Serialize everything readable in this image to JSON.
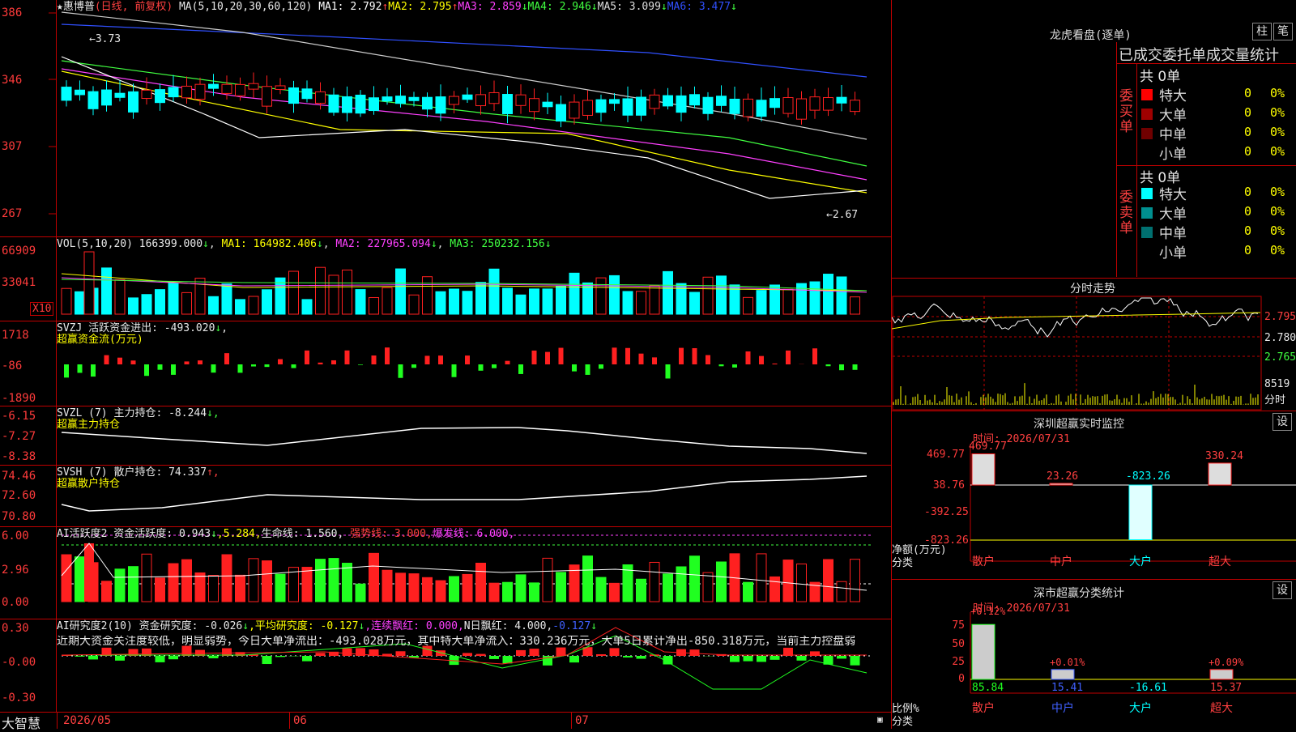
{
  "colors": {
    "up": "#ff2020",
    "down": "#00ffff",
    "grid": "#c00000",
    "axis": "#ff3b3b"
  },
  "main": {
    "star": "★",
    "name": "惠博普",
    "period": "(日线, 前复权)",
    "ma_params": "MA(5,10,20,30,60,120)",
    "ma": [
      {
        "label": "MA1: 2.792",
        "arrow": "↑",
        "color": "#ffffff"
      },
      {
        "label": "MA2: 2.795",
        "arrow": "↑",
        "color": "#ffff00"
      },
      {
        "label": "MA3: 2.859",
        "arrow": "↓",
        "color": "#ff40ff"
      },
      {
        "label": "MA4: 2.946",
        "arrow": "↓",
        "color": "#40ff40"
      },
      {
        "label": "MA5: 3.099",
        "arrow": "↓",
        "color": "#dddddd"
      },
      {
        "label": "MA6: 3.477",
        "arrow": "↓",
        "color": "#3050ff"
      }
    ],
    "yticks": [
      "386",
      "346",
      "307",
      "267"
    ],
    "hi_note": "3.73",
    "lo_note": "←2.67"
  },
  "vol": {
    "title": "VOL(5,10,20)",
    "value": "166399.000",
    "arrow": "↓",
    "ma1": "MA1: 164982.406",
    "ma1_arrow": "↓",
    "ma2": "MA2: 227965.094",
    "ma2_arrow": "↓",
    "ma3": "MA3: 250232.156",
    "ma3_arrow": "↓",
    "yticks": [
      "66909",
      "33041"
    ],
    "unit": "X10"
  },
  "svzj": {
    "title": "SVZJ  活跃资金进出: -493.020",
    "arrow": "↓",
    "sub": "超赢资金流(万元)",
    "yticks": [
      "1718",
      "-86",
      "-1890"
    ]
  },
  "svzl": {
    "title": "SVZL (7) 主力持仓: -8.244",
    "arrow": "↓,",
    "sub": "超赢主力持仓",
    "yticks": [
      "-6.15",
      "-7.27",
      "-8.38"
    ]
  },
  "svsh": {
    "title": "SVSH (7) 散户持仓: 74.337",
    "arrow": "↑,",
    "sub": "超赢散户持仓",
    "yticks": [
      "74.46",
      "72.60",
      "70.80"
    ]
  },
  "ai1": {
    "title": "AI活跃度2 资金活跃度: 0.943",
    "arrow": "↓",
    "v2": ",5.284,",
    "life": "生命线: 1.560,",
    "strong": "强势线: 3.000,",
    "burst": "爆发线: 6.000,",
    "yticks": [
      "6.00",
      "2.96",
      "0.00"
    ]
  },
  "ai2": {
    "title": "AI研究度2(10) 资金研究度: -0.026",
    "arrow": "↓",
    "avg": ",平均研究度: -0.127",
    "avg_arrow": "↓",
    "red": ",连续飘红: 0.000,",
    "nred": "N日飘红: 4.000,",
    "tail": "-0.127",
    "tail_arrow": "↓",
    "note": "近期大资金关注度较低，明显弱势，今日大单净流出：-493.028万元，其中特大单净流入：330.236万元，大单5日累计净出-850.318万元，当前主力控盘弱",
    "yticks": [
      "0.30",
      "-0.00",
      "-0.30"
    ]
  },
  "xaxis": {
    "brand": "大智慧",
    "labels": [
      "2026/05",
      "06",
      "07"
    ]
  },
  "lhb": {
    "title": "龙虎看盘(逐单)",
    "btn1": "柱",
    "btn2": "笔",
    "header": "已成交委托单成交量统计",
    "buy_label": [
      "委",
      "买",
      "单"
    ],
    "sell_label": [
      "委",
      "卖",
      "单"
    ],
    "buy_total": "共 0单",
    "sell_total": "共 0单",
    "buy_rows": [
      {
        "name": "特大",
        "n": "0",
        "p": "0%",
        "color": "#ff0000"
      },
      {
        "name": "大单",
        "n": "0",
        "p": "0%",
        "color": "#a00000"
      },
      {
        "name": "中单",
        "n": "0",
        "p": "0%",
        "color": "#700000"
      },
      {
        "name": "小单",
        "n": "0",
        "p": "0%",
        "color": ""
      }
    ],
    "sell_rows": [
      {
        "name": "特大",
        "n": "0",
        "p": "0%",
        "color": "#00ffff"
      },
      {
        "name": "大单",
        "n": "0",
        "p": "0%",
        "color": "#009090"
      },
      {
        "name": "中单",
        "n": "0",
        "p": "0%",
        "color": "#007070"
      },
      {
        "name": "小单",
        "n": "0",
        "p": "0%",
        "color": ""
      }
    ]
  },
  "fs": {
    "title": "分时走势",
    "yticks": [
      "2.795",
      "2.780",
      "2.765"
    ],
    "vol": "8519",
    "vol_unit": "分时"
  },
  "sz": {
    "title": "深圳超赢实时监控",
    "btn": "设",
    "time": "时间: 2026/07/31",
    "yticks": [
      "469.77",
      "38.76",
      "-392.25",
      "-823.26"
    ],
    "ylabel": "净额(万元)",
    "cat_label": "分类",
    "cats": [
      {
        "name": "散户",
        "value": "469.77",
        "num": 469.77
      },
      {
        "name": "中户",
        "value": "23.26",
        "num": 23.26
      },
      {
        "name": "大户",
        "value": "-823.26",
        "num": -823.26
      },
      {
        "name": "超大",
        "value": "330.24",
        "num": 330.24
      }
    ]
  },
  "sc": {
    "title": "深市超赢分类统计",
    "btn": "设",
    "time": "时间: 2026/07/31",
    "yticks": [
      "75",
      "50",
      "25",
      "0"
    ],
    "ylabel": "比例%",
    "cat_label": "分类",
    "cats": [
      {
        "name": "散户",
        "top": "+0.12%",
        "value": "85.84",
        "num": 85.84
      },
      {
        "name": "中户",
        "top": "+0.01%",
        "value": "15.41",
        "num": 15.41
      },
      {
        "name": "大户",
        "top": "",
        "value": "-16.61",
        "num": -16.61
      },
      {
        "name": "超大",
        "top": "+0.09%",
        "value": "15.37",
        "num": 15.37
      }
    ]
  }
}
